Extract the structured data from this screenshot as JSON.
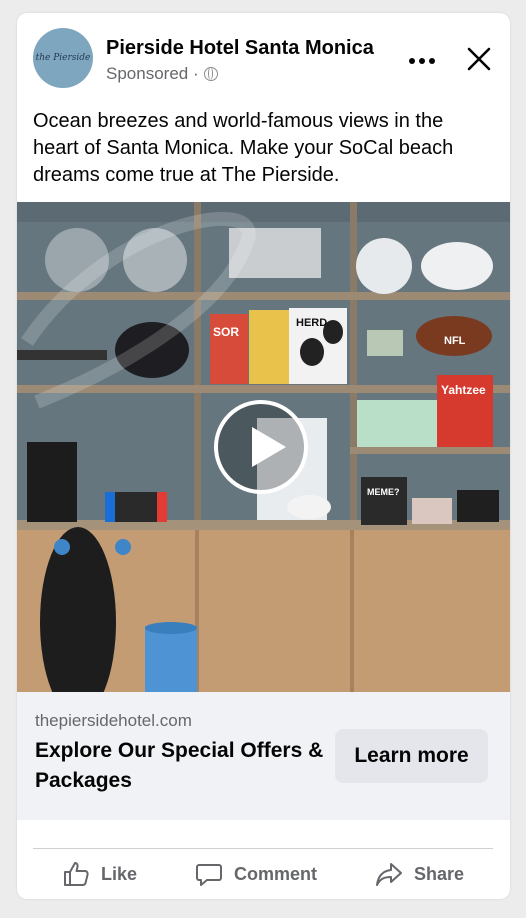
{
  "post": {
    "page_name": "Pierside Hotel Santa Monica",
    "sponsored_label": "Sponsored ·",
    "avatar_text": "the Pierside",
    "body": "Ocean breezes and world-famous views in the heart of Santa Monica. Make your SoCal beach dreams come true at The Pierside."
  },
  "media": {
    "box_texts": [
      "SOR",
      "HERD",
      "NFL",
      "Yahtzee",
      "MEME?"
    ]
  },
  "link": {
    "domain": "thepiersidehotel.com",
    "headline": "Explore Our Special Offers & Packages",
    "cta_label": "Learn more"
  },
  "actions": {
    "like": "Like",
    "comment": "Comment",
    "share": "Share"
  },
  "colors": {
    "text_primary": "#050505",
    "text_secondary": "#65676b",
    "link_bg": "#f0f2f5",
    "cta_bg": "#e4e6eb"
  }
}
